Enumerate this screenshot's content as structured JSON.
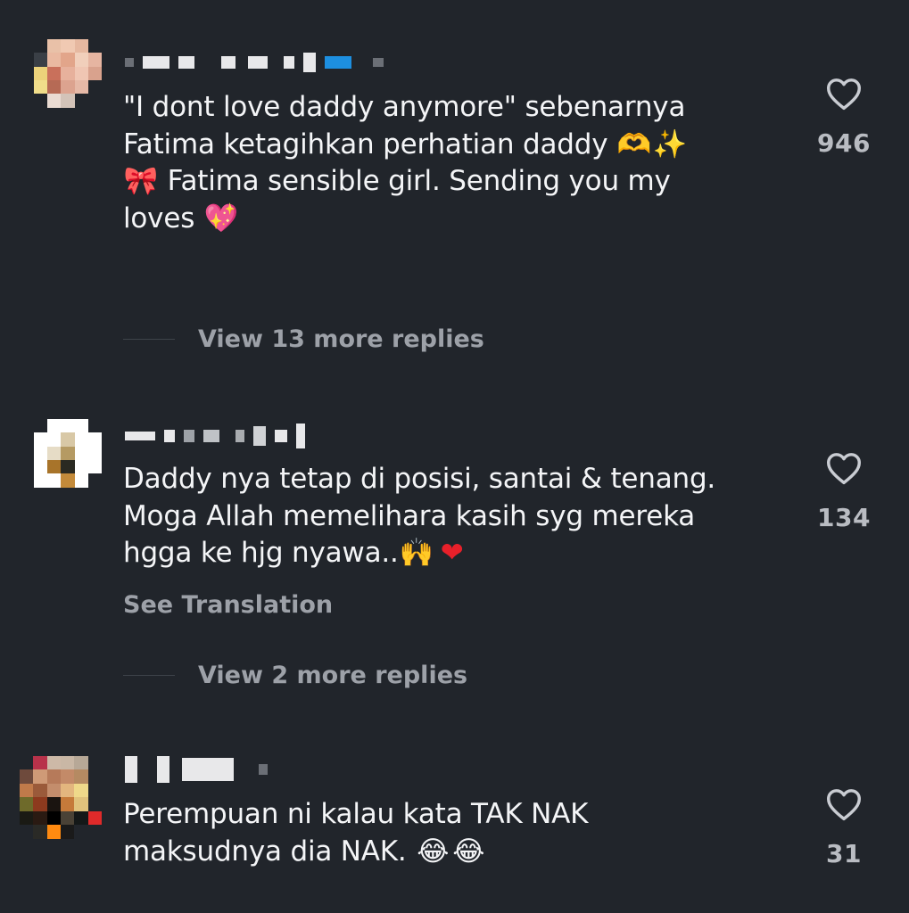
{
  "comments": [
    {
      "text_lines": [
        "\"I dont love daddy anymore\" sebenarnya",
        "Fatima ketagihkan perhatian daddy",
        "Fatima sensible girl. Sending you my",
        "loves"
      ],
      "emojis": [
        "🫶",
        "✨",
        "🎀",
        "💖"
      ],
      "like_count": "946",
      "view_replies_label": "View 13 more replies"
    },
    {
      "text_lines": [
        "Daddy nya tetap di posisi, santai & tenang.",
        "Moga Allah memelihara kasih syg mereka",
        "hgga ke hjg nyawa.."
      ],
      "emojis": [
        "🙌",
        "❤"
      ],
      "like_count": "134",
      "see_translation_label": "See Translation",
      "view_replies_label": "View 2 more replies"
    },
    {
      "text_lines": [
        "Perempuan ni kalau kata TAK NAK",
        "maksudnya dia NAK."
      ],
      "emojis": [
        "😂",
        "😂"
      ],
      "like_count": "31"
    }
  ],
  "icons": {
    "like": "heart-outline-icon"
  },
  "colors": {
    "background": "#21252b",
    "text": "#f4f5f7",
    "muted": "#9da1a8"
  }
}
